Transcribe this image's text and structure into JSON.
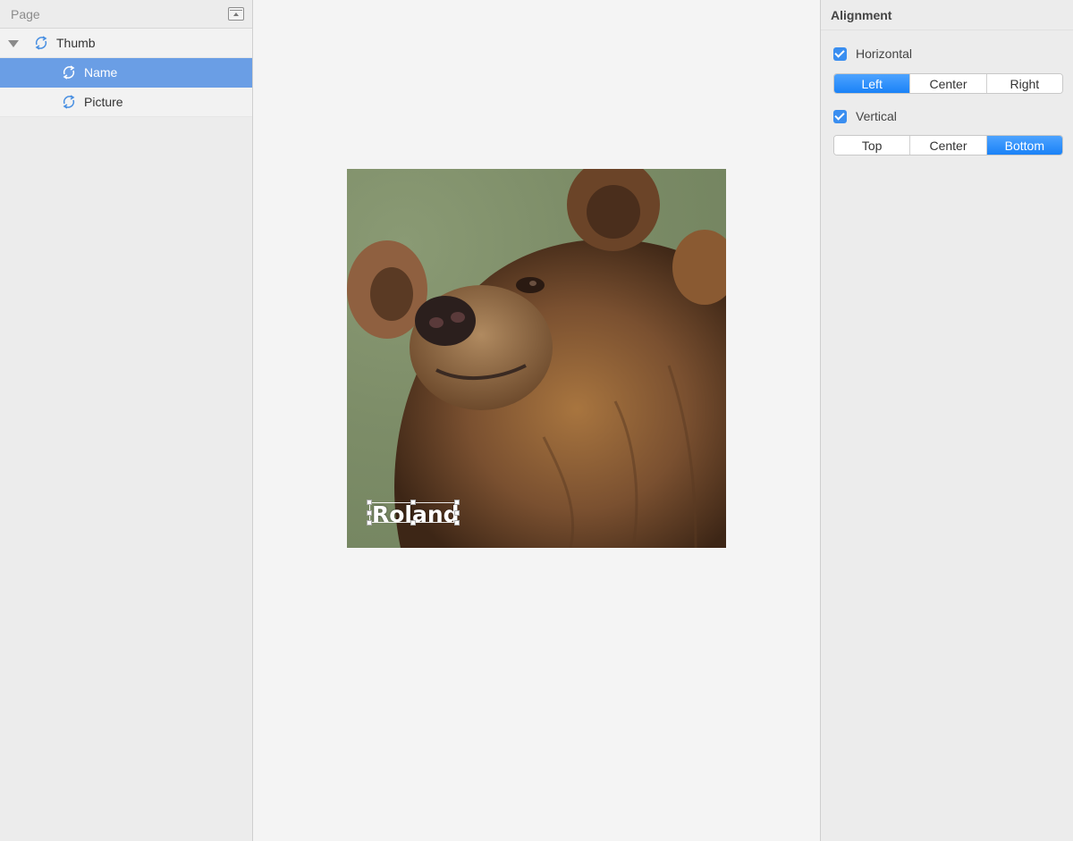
{
  "layers_panel": {
    "title": "Page",
    "layers": [
      {
        "label": "Thumb",
        "level": 0,
        "expanded": true,
        "selected": false
      },
      {
        "label": "Name",
        "level": 1,
        "selected": true
      },
      {
        "label": "Picture",
        "level": 1,
        "selected": false
      }
    ]
  },
  "canvas": {
    "artboard_image": "brown bear photo",
    "text_layer": "Roland"
  },
  "inspector": {
    "section_title": "Alignment",
    "horizontal": {
      "label": "Horizontal",
      "checked": true,
      "options": [
        "Left",
        "Center",
        "Right"
      ],
      "selected": "Left"
    },
    "vertical": {
      "label": "Vertical",
      "checked": true,
      "options": [
        "Top",
        "Center",
        "Bottom"
      ],
      "selected": "Bottom"
    }
  },
  "colors": {
    "selection": "#6a9ee5",
    "accent": "#1a82f7",
    "symbol_icon": "#4a90e2"
  }
}
